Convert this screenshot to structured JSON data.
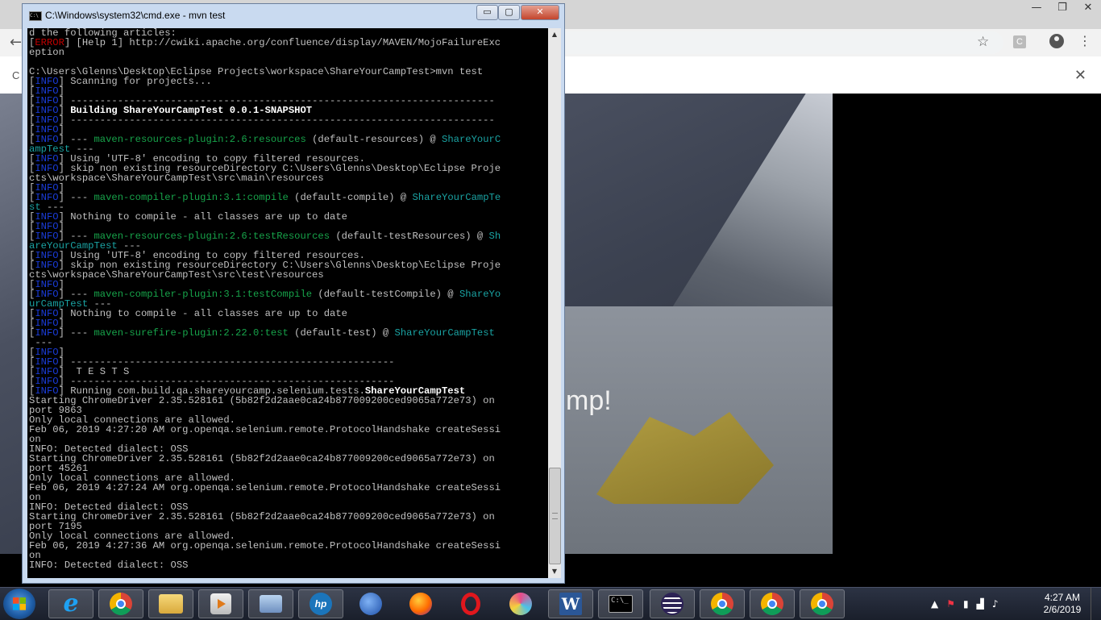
{
  "browser": {
    "controls": {
      "minimize": "—",
      "maximize": "❐",
      "close": "✕"
    },
    "back_icon": "←",
    "star_icon": "☆",
    "extension_icon": "C",
    "menu_icon": "⋮",
    "infobar_partial": "C",
    "infobar_close": "✕",
    "hero_text_partial": "mp!"
  },
  "cmd": {
    "title": "C:\\Windows\\system32\\cmd.exe - mvn  test",
    "buttons": {
      "minimize": "▭",
      "maximize": "▢",
      "close": "✕"
    },
    "scroll_up": "▲",
    "scroll_down": "▼",
    "lines": [
      [
        {
          "t": "d the following articles:"
        }
      ],
      [
        {
          "t": "["
        },
        {
          "t": "ERROR",
          "c": "lv-err"
        },
        {
          "t": "] [Help 1] http://cwiki.apache.org/confluence/display/MAVEN/MojoFailureExc"
        }
      ],
      [
        {
          "t": "eption"
        }
      ],
      [
        {
          "t": ""
        }
      ],
      [
        {
          "t": "C:\\Users\\Glenns\\Desktop\\Eclipse Projects\\workspace\\ShareYourCampTest>mvn test"
        }
      ],
      [
        {
          "t": "["
        },
        {
          "t": "INFO",
          "c": "lv"
        },
        {
          "t": "] Scanning for projects..."
        }
      ],
      [
        {
          "t": "["
        },
        {
          "t": "INFO",
          "c": "lv"
        },
        {
          "t": "]"
        }
      ],
      [
        {
          "t": "["
        },
        {
          "t": "INFO",
          "c": "lv"
        },
        {
          "t": "] ------------------------------------------------------------------------"
        }
      ],
      [
        {
          "t": "["
        },
        {
          "t": "INFO",
          "c": "lv"
        },
        {
          "t": "] "
        },
        {
          "t": "Building ShareYourCampTest 0.0.1-SNAPSHOT",
          "c": "b"
        }
      ],
      [
        {
          "t": "["
        },
        {
          "t": "INFO",
          "c": "lv"
        },
        {
          "t": "] ------------------------------------------------------------------------"
        }
      ],
      [
        {
          "t": "["
        },
        {
          "t": "INFO",
          "c": "lv"
        },
        {
          "t": "]"
        }
      ],
      [
        {
          "t": "["
        },
        {
          "t": "INFO",
          "c": "lv"
        },
        {
          "t": "] --- "
        },
        {
          "t": "maven-resources-plugin:2.6:resources",
          "c": "g"
        },
        {
          "t": " (default-resources) @ "
        },
        {
          "t": "ShareYourC",
          "c": "t"
        }
      ],
      [
        {
          "t": "ampTest",
          "c": "t"
        },
        {
          "t": " ---"
        }
      ],
      [
        {
          "t": "["
        },
        {
          "t": "INFO",
          "c": "lv"
        },
        {
          "t": "] Using 'UTF-8' encoding to copy filtered resources."
        }
      ],
      [
        {
          "t": "["
        },
        {
          "t": "INFO",
          "c": "lv"
        },
        {
          "t": "] skip non existing resourceDirectory C:\\Users\\Glenns\\Desktop\\Eclipse Proje"
        }
      ],
      [
        {
          "t": "cts\\workspace\\ShareYourCampTest\\src\\main\\resources"
        }
      ],
      [
        {
          "t": "["
        },
        {
          "t": "INFO",
          "c": "lv"
        },
        {
          "t": "]"
        }
      ],
      [
        {
          "t": "["
        },
        {
          "t": "INFO",
          "c": "lv"
        },
        {
          "t": "] --- "
        },
        {
          "t": "maven-compiler-plugin:3.1:compile",
          "c": "g"
        },
        {
          "t": " (default-compile) @ "
        },
        {
          "t": "ShareYourCampTe",
          "c": "t"
        }
      ],
      [
        {
          "t": "st",
          "c": "t"
        },
        {
          "t": " ---"
        }
      ],
      [
        {
          "t": "["
        },
        {
          "t": "INFO",
          "c": "lv"
        },
        {
          "t": "] Nothing to compile - all classes are up to date"
        }
      ],
      [
        {
          "t": "["
        },
        {
          "t": "INFO",
          "c": "lv"
        },
        {
          "t": "]"
        }
      ],
      [
        {
          "t": "["
        },
        {
          "t": "INFO",
          "c": "lv"
        },
        {
          "t": "] --- "
        },
        {
          "t": "maven-resources-plugin:2.6:testResources",
          "c": "g"
        },
        {
          "t": " (default-testResources) @ "
        },
        {
          "t": "Sh",
          "c": "t"
        }
      ],
      [
        {
          "t": "areYourCampTest",
          "c": "t"
        },
        {
          "t": " ---"
        }
      ],
      [
        {
          "t": "["
        },
        {
          "t": "INFO",
          "c": "lv"
        },
        {
          "t": "] Using 'UTF-8' encoding to copy filtered resources."
        }
      ],
      [
        {
          "t": "["
        },
        {
          "t": "INFO",
          "c": "lv"
        },
        {
          "t": "] skip non existing resourceDirectory C:\\Users\\Glenns\\Desktop\\Eclipse Proje"
        }
      ],
      [
        {
          "t": "cts\\workspace\\ShareYourCampTest\\src\\test\\resources"
        }
      ],
      [
        {
          "t": "["
        },
        {
          "t": "INFO",
          "c": "lv"
        },
        {
          "t": "]"
        }
      ],
      [
        {
          "t": "["
        },
        {
          "t": "INFO",
          "c": "lv"
        },
        {
          "t": "] --- "
        },
        {
          "t": "maven-compiler-plugin:3.1:testCompile",
          "c": "g"
        },
        {
          "t": " (default-testCompile) @ "
        },
        {
          "t": "ShareYo",
          "c": "t"
        }
      ],
      [
        {
          "t": "urCampTest",
          "c": "t"
        },
        {
          "t": " ---"
        }
      ],
      [
        {
          "t": "["
        },
        {
          "t": "INFO",
          "c": "lv"
        },
        {
          "t": "] Nothing to compile - all classes are up to date"
        }
      ],
      [
        {
          "t": "["
        },
        {
          "t": "INFO",
          "c": "lv"
        },
        {
          "t": "]"
        }
      ],
      [
        {
          "t": "["
        },
        {
          "t": "INFO",
          "c": "lv"
        },
        {
          "t": "] --- "
        },
        {
          "t": "maven-surefire-plugin:2.22.0:test",
          "c": "g"
        },
        {
          "t": " (default-test) @ "
        },
        {
          "t": "ShareYourCampTest",
          "c": "t"
        }
      ],
      [
        {
          "t": " ---"
        }
      ],
      [
        {
          "t": "["
        },
        {
          "t": "INFO",
          "c": "lv"
        },
        {
          "t": "]"
        }
      ],
      [
        {
          "t": "["
        },
        {
          "t": "INFO",
          "c": "lv"
        },
        {
          "t": "] -------------------------------------------------------"
        }
      ],
      [
        {
          "t": "["
        },
        {
          "t": "INFO",
          "c": "lv"
        },
        {
          "t": "]  T E S T S"
        }
      ],
      [
        {
          "t": "["
        },
        {
          "t": "INFO",
          "c": "lv"
        },
        {
          "t": "] -------------------------------------------------------"
        }
      ],
      [
        {
          "t": "["
        },
        {
          "t": "INFO",
          "c": "lv"
        },
        {
          "t": "] Running com.build.qa.shareyourcamp.selenium.tests."
        },
        {
          "t": "ShareYourCampTest",
          "c": "b"
        }
      ],
      [
        {
          "t": "Starting ChromeDriver 2.35.528161 (5b82f2d2aae0ca24b877009200ced9065a772e73) on"
        }
      ],
      [
        {
          "t": "port 9863"
        }
      ],
      [
        {
          "t": "Only local connections are allowed."
        }
      ],
      [
        {
          "t": "Feb 06, 2019 4:27:20 AM org.openqa.selenium.remote.ProtocolHandshake createSessi"
        }
      ],
      [
        {
          "t": "on"
        }
      ],
      [
        {
          "t": "INFO: Detected dialect: OSS"
        }
      ],
      [
        {
          "t": "Starting ChromeDriver 2.35.528161 (5b82f2d2aae0ca24b877009200ced9065a772e73) on"
        }
      ],
      [
        {
          "t": "port 45261"
        }
      ],
      [
        {
          "t": "Only local connections are allowed."
        }
      ],
      [
        {
          "t": "Feb 06, 2019 4:27:24 AM org.openqa.selenium.remote.ProtocolHandshake createSessi"
        }
      ],
      [
        {
          "t": "on"
        }
      ],
      [
        {
          "t": "INFO: Detected dialect: OSS"
        }
      ],
      [
        {
          "t": "Starting ChromeDriver 2.35.528161 (5b82f2d2aae0ca24b877009200ced9065a772e73) on"
        }
      ],
      [
        {
          "t": "port 7195"
        }
      ],
      [
        {
          "t": "Only local connections are allowed."
        }
      ],
      [
        {
          "t": "Feb 06, 2019 4:27:36 AM org.openqa.selenium.remote.ProtocolHandshake createSessi"
        }
      ],
      [
        {
          "t": "on"
        }
      ],
      [
        {
          "t": "INFO: Detected dialect: OSS"
        }
      ]
    ]
  },
  "taskbar": {
    "items": [
      {
        "name": "internet-explorer",
        "icon": "ie-icon",
        "label": "e"
      },
      {
        "name": "chrome",
        "icon": "chrome-icon",
        "label": ""
      },
      {
        "name": "file-explorer",
        "icon": "folder-icon",
        "label": ""
      },
      {
        "name": "media-player",
        "icon": "media-player-icon",
        "label": ""
      },
      {
        "name": "app-window",
        "icon": "app-icon",
        "label": ""
      },
      {
        "name": "hp-app",
        "icon": "hp-icon",
        "label": "hp"
      },
      {
        "name": "thunderbird",
        "icon": "thunderbird-icon",
        "label": ""
      },
      {
        "name": "firefox",
        "icon": "firefox-icon",
        "label": ""
      },
      {
        "name": "opera",
        "icon": "opera-icon",
        "label": ""
      },
      {
        "name": "swirl-app",
        "icon": "swirl-icon",
        "label": ""
      },
      {
        "name": "word",
        "icon": "word-icon",
        "label": "W"
      },
      {
        "name": "cmd",
        "icon": "cmd-icon",
        "label": "C:\\_"
      },
      {
        "name": "eclipse",
        "icon": "eclipse-icon",
        "label": ""
      },
      {
        "name": "chrome-2",
        "icon": "chrome-icon",
        "label": ""
      },
      {
        "name": "chrome-3",
        "icon": "chrome-icon",
        "label": ""
      },
      {
        "name": "chrome-4",
        "icon": "chrome-icon",
        "label": ""
      }
    ],
    "tray": {
      "chevron": "▲",
      "flag": "⚑",
      "battery": "▮",
      "network": "▟",
      "volume": "♪"
    },
    "clock": {
      "time": "4:27 AM",
      "date": "2/6/2019"
    }
  }
}
